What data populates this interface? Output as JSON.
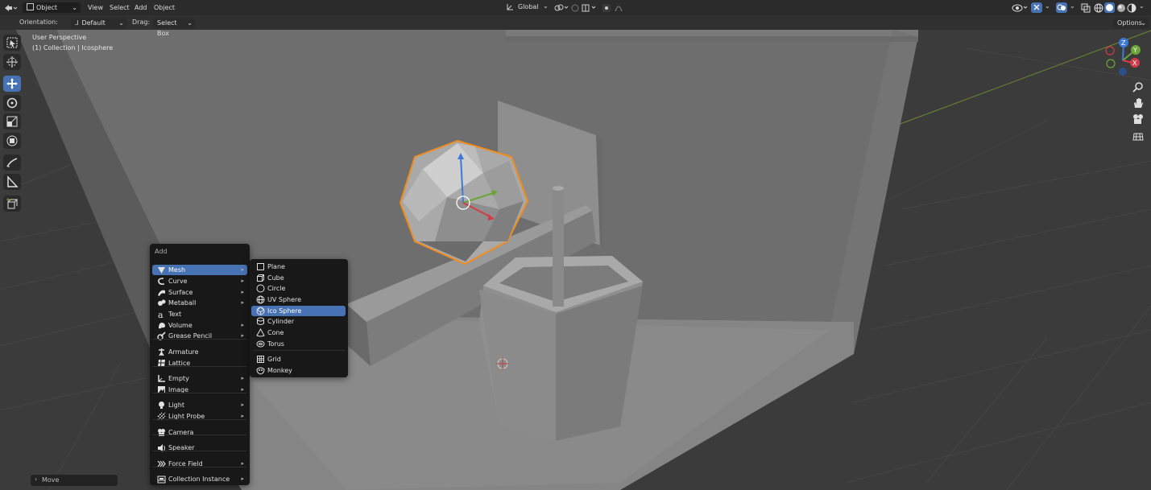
{
  "header": {
    "mode": "Object Mode",
    "menus": [
      "View",
      "Select",
      "Add",
      "Object"
    ],
    "transform_orientation": "Global",
    "options_label": "Options"
  },
  "tool_settings": {
    "orientation_label": "Orientation:",
    "orientation_value": "Default",
    "drag_label": "Drag:",
    "drag_value": "Select Box"
  },
  "viewport": {
    "view_name": "User Perspective",
    "collection_info": "(1) Collection | Icosphere",
    "gizmo_axes": [
      "Z",
      "Y",
      "X"
    ]
  },
  "add_menu": {
    "title": "Add",
    "items": [
      {
        "label": "Mesh",
        "icon": "mesh-icon",
        "submenu": true,
        "highlighted": true
      },
      {
        "label": "Curve",
        "icon": "curve-icon",
        "submenu": true
      },
      {
        "label": "Surface",
        "icon": "surface-icon",
        "submenu": true
      },
      {
        "label": "Metaball",
        "icon": "metaball-icon",
        "submenu": true
      },
      {
        "label": "Text",
        "icon": "text-icon",
        "submenu": false
      },
      {
        "label": "Volume",
        "icon": "volume-icon",
        "submenu": true
      },
      {
        "label": "Grease Pencil",
        "icon": "grease-pencil-icon",
        "submenu": true
      },
      {
        "label": "Armature",
        "icon": "armature-icon",
        "submenu": false
      },
      {
        "label": "Lattice",
        "icon": "lattice-icon",
        "submenu": false
      },
      {
        "label": "Empty",
        "icon": "empty-icon",
        "submenu": true
      },
      {
        "label": "Image",
        "icon": "image-icon",
        "submenu": true
      },
      {
        "label": "Light",
        "icon": "light-icon",
        "submenu": true
      },
      {
        "label": "Light Probe",
        "icon": "light-probe-icon",
        "submenu": true
      },
      {
        "label": "Camera",
        "icon": "camera-icon",
        "submenu": false
      },
      {
        "label": "Speaker",
        "icon": "speaker-icon",
        "submenu": false
      },
      {
        "label": "Force Field",
        "icon": "force-field-icon",
        "submenu": true
      },
      {
        "label": "Collection Instance",
        "icon": "collection-instance-icon",
        "submenu": true
      }
    ]
  },
  "mesh_menu": {
    "items": [
      {
        "label": "Plane",
        "icon": "plane-icon"
      },
      {
        "label": "Cube",
        "icon": "cube-icon"
      },
      {
        "label": "Circle",
        "icon": "circle-icon"
      },
      {
        "label": "UV Sphere",
        "icon": "uv-sphere-icon"
      },
      {
        "label": "Ico Sphere",
        "icon": "ico-sphere-icon",
        "highlighted": true
      },
      {
        "label": "Cylinder",
        "icon": "cylinder-icon"
      },
      {
        "label": "Cone",
        "icon": "cone-icon"
      },
      {
        "label": "Torus",
        "icon": "torus-icon"
      },
      {
        "label": "Grid",
        "icon": "grid-icon"
      },
      {
        "label": "Monkey",
        "icon": "monkey-icon"
      }
    ]
  },
  "operator_panel": {
    "label": "Move"
  },
  "colors": {
    "accent": "#4772b3",
    "selection_outline": "#f28c1e",
    "axis_x": "#d23c48",
    "axis_y": "#6ba53a",
    "axis_z": "#3d7ad8"
  }
}
